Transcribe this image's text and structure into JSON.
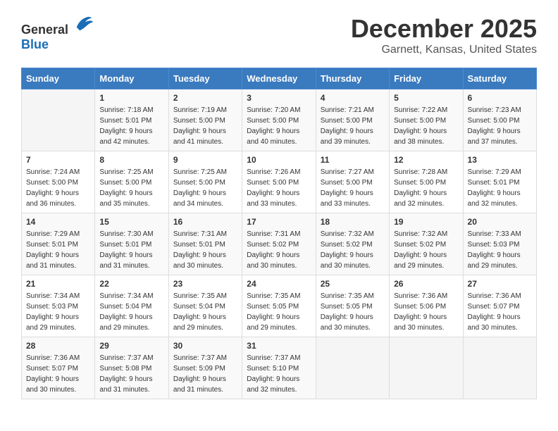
{
  "logo": {
    "text_general": "General",
    "text_blue": "Blue"
  },
  "title": "December 2025",
  "subtitle": "Garnett, Kansas, United States",
  "calendar": {
    "headers": [
      "Sunday",
      "Monday",
      "Tuesday",
      "Wednesday",
      "Thursday",
      "Friday",
      "Saturday"
    ],
    "weeks": [
      [
        {
          "day": "",
          "sunrise": "",
          "sunset": "",
          "daylight": ""
        },
        {
          "day": "1",
          "sunrise": "Sunrise: 7:18 AM",
          "sunset": "Sunset: 5:01 PM",
          "daylight": "Daylight: 9 hours and 42 minutes."
        },
        {
          "day": "2",
          "sunrise": "Sunrise: 7:19 AM",
          "sunset": "Sunset: 5:00 PM",
          "daylight": "Daylight: 9 hours and 41 minutes."
        },
        {
          "day": "3",
          "sunrise": "Sunrise: 7:20 AM",
          "sunset": "Sunset: 5:00 PM",
          "daylight": "Daylight: 9 hours and 40 minutes."
        },
        {
          "day": "4",
          "sunrise": "Sunrise: 7:21 AM",
          "sunset": "Sunset: 5:00 PM",
          "daylight": "Daylight: 9 hours and 39 minutes."
        },
        {
          "day": "5",
          "sunrise": "Sunrise: 7:22 AM",
          "sunset": "Sunset: 5:00 PM",
          "daylight": "Daylight: 9 hours and 38 minutes."
        },
        {
          "day": "6",
          "sunrise": "Sunrise: 7:23 AM",
          "sunset": "Sunset: 5:00 PM",
          "daylight": "Daylight: 9 hours and 37 minutes."
        }
      ],
      [
        {
          "day": "7",
          "sunrise": "Sunrise: 7:24 AM",
          "sunset": "Sunset: 5:00 PM",
          "daylight": "Daylight: 9 hours and 36 minutes."
        },
        {
          "day": "8",
          "sunrise": "Sunrise: 7:25 AM",
          "sunset": "Sunset: 5:00 PM",
          "daylight": "Daylight: 9 hours and 35 minutes."
        },
        {
          "day": "9",
          "sunrise": "Sunrise: 7:25 AM",
          "sunset": "Sunset: 5:00 PM",
          "daylight": "Daylight: 9 hours and 34 minutes."
        },
        {
          "day": "10",
          "sunrise": "Sunrise: 7:26 AM",
          "sunset": "Sunset: 5:00 PM",
          "daylight": "Daylight: 9 hours and 33 minutes."
        },
        {
          "day": "11",
          "sunrise": "Sunrise: 7:27 AM",
          "sunset": "Sunset: 5:00 PM",
          "daylight": "Daylight: 9 hours and 33 minutes."
        },
        {
          "day": "12",
          "sunrise": "Sunrise: 7:28 AM",
          "sunset": "Sunset: 5:00 PM",
          "daylight": "Daylight: 9 hours and 32 minutes."
        },
        {
          "day": "13",
          "sunrise": "Sunrise: 7:29 AM",
          "sunset": "Sunset: 5:01 PM",
          "daylight": "Daylight: 9 hours and 32 minutes."
        }
      ],
      [
        {
          "day": "14",
          "sunrise": "Sunrise: 7:29 AM",
          "sunset": "Sunset: 5:01 PM",
          "daylight": "Daylight: 9 hours and 31 minutes."
        },
        {
          "day": "15",
          "sunrise": "Sunrise: 7:30 AM",
          "sunset": "Sunset: 5:01 PM",
          "daylight": "Daylight: 9 hours and 31 minutes."
        },
        {
          "day": "16",
          "sunrise": "Sunrise: 7:31 AM",
          "sunset": "Sunset: 5:01 PM",
          "daylight": "Daylight: 9 hours and 30 minutes."
        },
        {
          "day": "17",
          "sunrise": "Sunrise: 7:31 AM",
          "sunset": "Sunset: 5:02 PM",
          "daylight": "Daylight: 9 hours and 30 minutes."
        },
        {
          "day": "18",
          "sunrise": "Sunrise: 7:32 AM",
          "sunset": "Sunset: 5:02 PM",
          "daylight": "Daylight: 9 hours and 30 minutes."
        },
        {
          "day": "19",
          "sunrise": "Sunrise: 7:32 AM",
          "sunset": "Sunset: 5:02 PM",
          "daylight": "Daylight: 9 hours and 29 minutes."
        },
        {
          "day": "20",
          "sunrise": "Sunrise: 7:33 AM",
          "sunset": "Sunset: 5:03 PM",
          "daylight": "Daylight: 9 hours and 29 minutes."
        }
      ],
      [
        {
          "day": "21",
          "sunrise": "Sunrise: 7:34 AM",
          "sunset": "Sunset: 5:03 PM",
          "daylight": "Daylight: 9 hours and 29 minutes."
        },
        {
          "day": "22",
          "sunrise": "Sunrise: 7:34 AM",
          "sunset": "Sunset: 5:04 PM",
          "daylight": "Daylight: 9 hours and 29 minutes."
        },
        {
          "day": "23",
          "sunrise": "Sunrise: 7:35 AM",
          "sunset": "Sunset: 5:04 PM",
          "daylight": "Daylight: 9 hours and 29 minutes."
        },
        {
          "day": "24",
          "sunrise": "Sunrise: 7:35 AM",
          "sunset": "Sunset: 5:05 PM",
          "daylight": "Daylight: 9 hours and 29 minutes."
        },
        {
          "day": "25",
          "sunrise": "Sunrise: 7:35 AM",
          "sunset": "Sunset: 5:05 PM",
          "daylight": "Daylight: 9 hours and 30 minutes."
        },
        {
          "day": "26",
          "sunrise": "Sunrise: 7:36 AM",
          "sunset": "Sunset: 5:06 PM",
          "daylight": "Daylight: 9 hours and 30 minutes."
        },
        {
          "day": "27",
          "sunrise": "Sunrise: 7:36 AM",
          "sunset": "Sunset: 5:07 PM",
          "daylight": "Daylight: 9 hours and 30 minutes."
        }
      ],
      [
        {
          "day": "28",
          "sunrise": "Sunrise: 7:36 AM",
          "sunset": "Sunset: 5:07 PM",
          "daylight": "Daylight: 9 hours and 30 minutes."
        },
        {
          "day": "29",
          "sunrise": "Sunrise: 7:37 AM",
          "sunset": "Sunset: 5:08 PM",
          "daylight": "Daylight: 9 hours and 31 minutes."
        },
        {
          "day": "30",
          "sunrise": "Sunrise: 7:37 AM",
          "sunset": "Sunset: 5:09 PM",
          "daylight": "Daylight: 9 hours and 31 minutes."
        },
        {
          "day": "31",
          "sunrise": "Sunrise: 7:37 AM",
          "sunset": "Sunset: 5:10 PM",
          "daylight": "Daylight: 9 hours and 32 minutes."
        },
        {
          "day": "",
          "sunrise": "",
          "sunset": "",
          "daylight": ""
        },
        {
          "day": "",
          "sunrise": "",
          "sunset": "",
          "daylight": ""
        },
        {
          "day": "",
          "sunrise": "",
          "sunset": "",
          "daylight": ""
        }
      ]
    ]
  }
}
